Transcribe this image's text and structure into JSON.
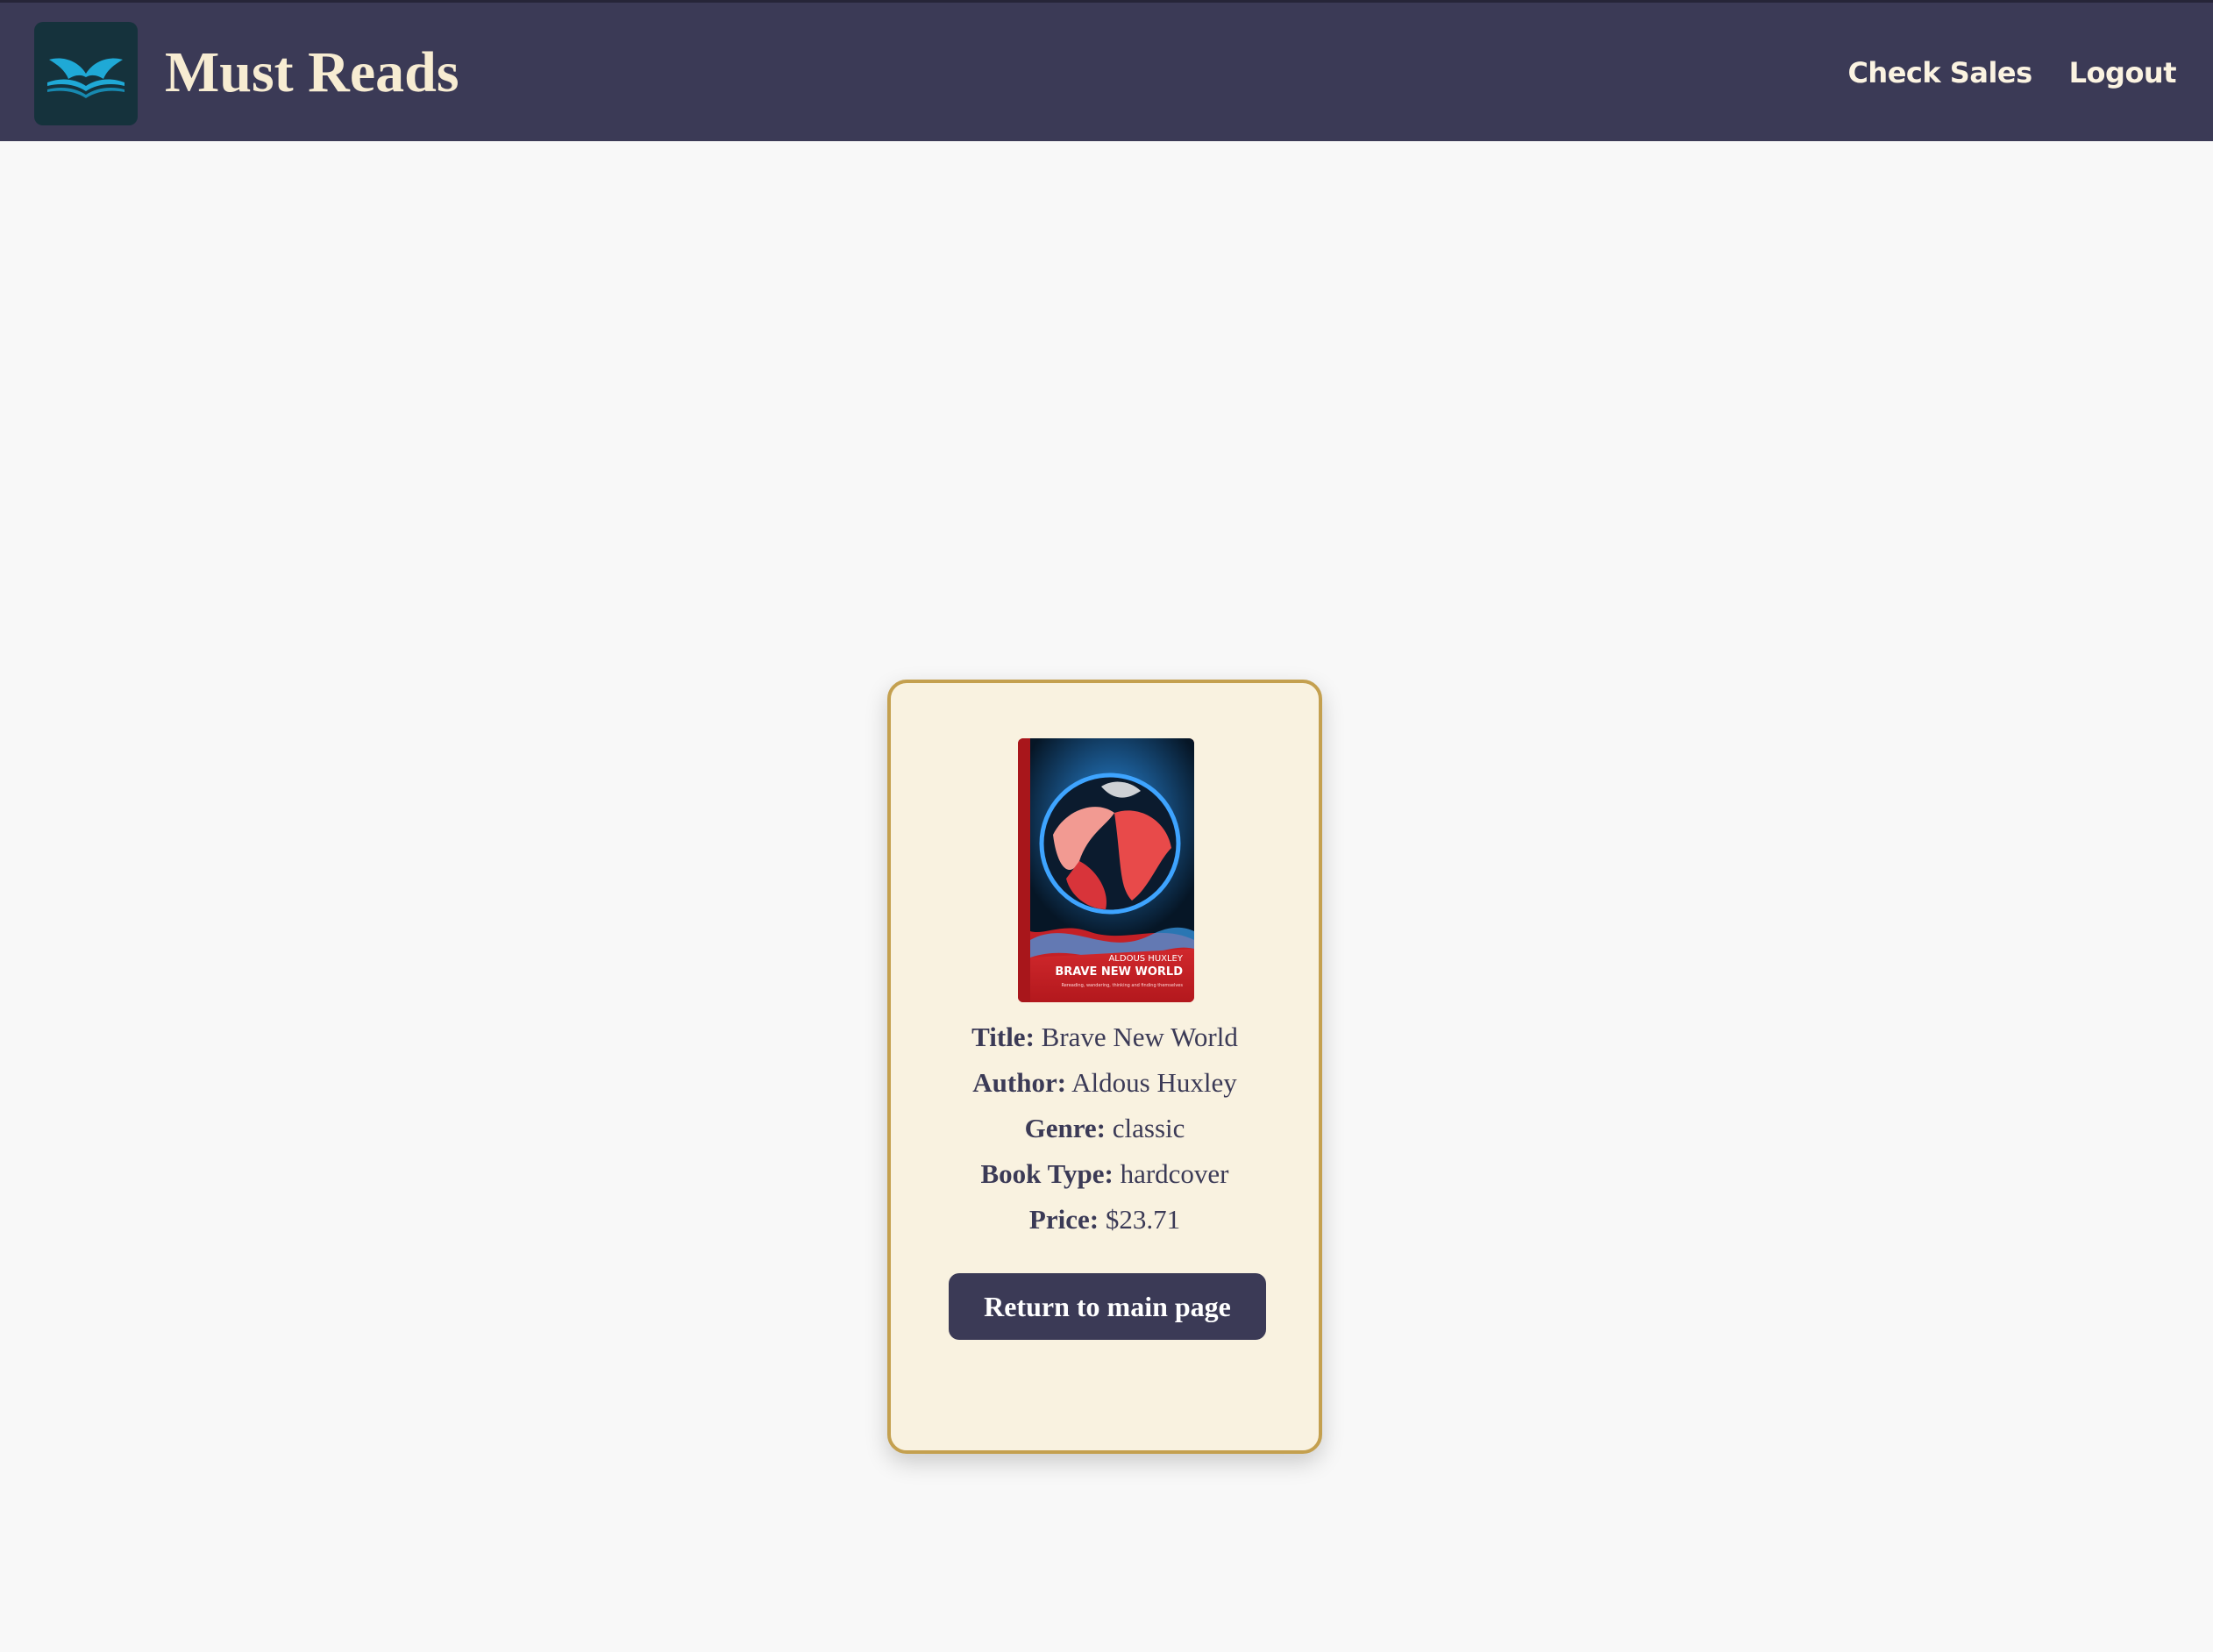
{
  "app": {
    "brand_name": "Must Reads",
    "logo_icon": "open-book-icon",
    "colors": {
      "header_bg": "#3b3a56",
      "brand_text": "#f7ecd2",
      "card_bg": "#f9f2e0",
      "card_border": "#c4a04f",
      "button_bg": "#3b3a56"
    }
  },
  "nav": {
    "items": [
      {
        "label": "Check Sales"
      },
      {
        "label": "Logout"
      }
    ]
  },
  "book": {
    "cover": {
      "author": "ALDOUS HUXLEY",
      "title": "BRAVE NEW WORLD",
      "tagline": "Rereading, wandering, thinking and finding themselves"
    },
    "fields": [
      {
        "label": "Title:",
        "value": "Brave New World"
      },
      {
        "label": "Author:",
        "value": "Aldous Huxley"
      },
      {
        "label": "Genre:",
        "value": "classic"
      },
      {
        "label": "Book Type:",
        "value": "hardcover"
      },
      {
        "label": "Price:",
        "value": "$23.71"
      }
    ]
  },
  "actions": {
    "return_label": "Return to main page"
  }
}
